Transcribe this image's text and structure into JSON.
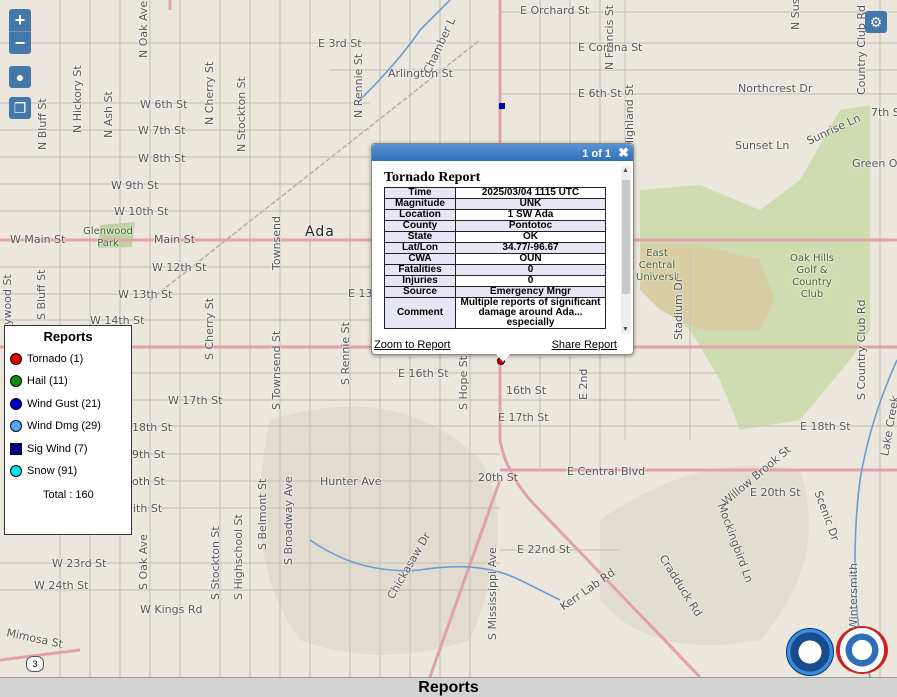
{
  "map": {
    "city_label": "Ada",
    "street_labels": [
      "E Orchard St",
      "E Corona St",
      "E 3rd St",
      "Arlington St",
      "E 6th St",
      "Northcrest Dr",
      "W 6th St",
      "W 7th St",
      "W 8th St",
      "W 9th St",
      "W 10th St",
      "W Main St",
      "Main St",
      "W 12th St",
      "W 13th St",
      "E 13",
      "W 14th St",
      "E 16th St",
      "16th St",
      "W 17th St",
      "E 17th St",
      "E 18th St",
      "E Central Blvd",
      "Hunter Ave",
      "20th St",
      "E 20th St",
      "E 22nd St",
      "W 23rd St",
      "W 24th St",
      "W Kings Rd",
      "Kerr Lab Rd",
      "Sunset Ln",
      "Sunrise Ln",
      "7th St",
      "Green Oa",
      "Cradduck Rd",
      "Mimosa St",
      "Chickasaw Dr",
      "Willow Brook St",
      "Mockingbird Ln",
      "Scenic Dr",
      "Lake Creek",
      "Wintersmith",
      "N Oak Ave",
      "N Hickory St",
      "N Ash St",
      "N Bluff St",
      "N Cherry St",
      "N Stockton St",
      "N Rennie St",
      "N Francis St",
      "N Highland St",
      "Country Club Rd",
      "S Country Club Rd",
      "Townsend",
      "S Townsend St",
      "S Rennie St",
      "S Hope St",
      "S Mississippi Ave",
      "S Cherry St",
      "S Bluff St",
      "S Oak Ave",
      "S Stockton St",
      "S Highschool St",
      "S Belmont St",
      "S Broadway Ave",
      "Stadium Dr",
      "Chamber L",
      "ywood St",
      "oth St",
      "9th St",
      "ith St",
      "1st St",
      "18th St",
      "N Susa",
      "E 2nd",
      "N Mississippi Ave"
    ],
    "park_labels": [
      "Glenwood Park",
      "Oak Hills Golf & Country Club",
      "East Central University"
    ],
    "highway_shield": "3"
  },
  "controls": {
    "zoom_in": "+",
    "zoom_out": "−"
  },
  "legend": {
    "title": "Reports",
    "items": [
      {
        "label": "Tornado (1)",
        "color": "#e00000",
        "shape": "circle"
      },
      {
        "label": "Hail (11)",
        "color": "#0a8a0a",
        "shape": "circle"
      },
      {
        "label": "Wind Gust (21)",
        "color": "#0000cc",
        "shape": "circle"
      },
      {
        "label": "Wind Dmg (29)",
        "color": "#55aaff",
        "shape": "circle"
      },
      {
        "label": "Sig Wind (7)",
        "color": "#00008b",
        "shape": "square"
      },
      {
        "label": "Snow (91)",
        "color": "#00e5ee",
        "shape": "circle"
      }
    ],
    "total": "Total : 160"
  },
  "popup": {
    "counter": "1 of 1",
    "close_glyph": "✖",
    "title": "Tornado Report",
    "rows": [
      {
        "k": "Time",
        "v": "2025/03/04 1115 UTC"
      },
      {
        "k": "Magnitude",
        "v": "UNK"
      },
      {
        "k": "Location",
        "v": "1 SW Ada"
      },
      {
        "k": "County",
        "v": "Pontotoc"
      },
      {
        "k": "State",
        "v": "OK"
      },
      {
        "k": "Lat/Lon",
        "v": "34.77/-96.67"
      },
      {
        "k": "CWA",
        "v": "OUN"
      },
      {
        "k": "Fatalities",
        "v": "0"
      },
      {
        "k": "Injuries",
        "v": "0"
      },
      {
        "k": "Source",
        "v": "Emergency Mngr"
      },
      {
        "k": "Comment",
        "v": "Multiple reports of significant damage around Ada... especially"
      }
    ],
    "zoom_link": "Zoom to Report",
    "share_link": "Share Report"
  },
  "footer": {
    "title": "Reports"
  },
  "logos": {
    "noaa": "NOAA",
    "nws": "NATIONAL WEATHER SERVICE"
  }
}
